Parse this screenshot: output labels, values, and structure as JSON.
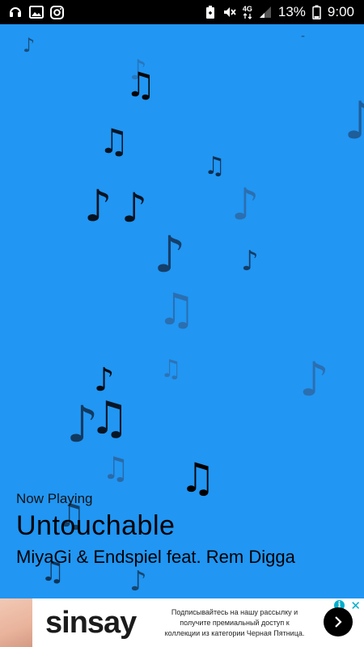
{
  "status_bar": {
    "battery_percent": "13%",
    "time": "9:00",
    "network_label": "4G",
    "left_icons": [
      "headset-icon",
      "image-icon",
      "instagram-icon"
    ],
    "right_icons": [
      "battery-saver-icon",
      "mute-icon",
      "network-4g-icon",
      "signal-icon",
      "battery-icon"
    ]
  },
  "player": {
    "now_playing_label": "Now Playing",
    "title": "Untouchable",
    "artist": "MiyaGi & Endspiel feat. Rem Digga"
  },
  "background": {
    "color": "#2196f3",
    "note_icons": [
      "music-note-icon",
      "beamed-notes-icon"
    ]
  },
  "ad": {
    "brand": "sinsay",
    "text": "Подписывайтесь на нашу рассылку и получите премиальный доступ к коллекции из категории Черная Пятница.",
    "info_icon": "i",
    "close_icon": "✕",
    "accent_color": "#00aecd"
  }
}
